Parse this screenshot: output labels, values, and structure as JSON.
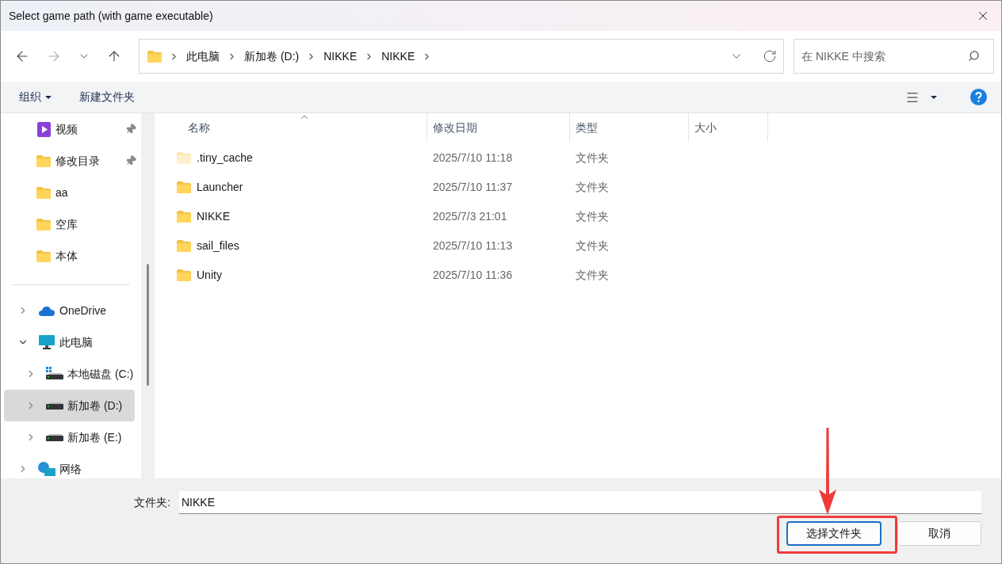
{
  "window": {
    "title": "Select game path (with game executable)"
  },
  "address_bar": {
    "crumbs": [
      "此电脑",
      "新加卷 (D:)",
      "NIKKE",
      "NIKKE"
    ]
  },
  "search": {
    "placeholder": "在 NIKKE 中搜索"
  },
  "toolbar": {
    "organize": "组织",
    "new_folder": "新建文件夹"
  },
  "sidebar": {
    "quick_access": [
      {
        "label": "视频",
        "kind": "video",
        "pinned": true
      },
      {
        "label": "修改目录",
        "kind": "folder",
        "pinned": true
      },
      {
        "label": "aa",
        "kind": "folder",
        "pinned": false
      },
      {
        "label": "空库",
        "kind": "folder",
        "pinned": false
      },
      {
        "label": "本体",
        "kind": "folder",
        "pinned": false
      }
    ],
    "tree": [
      {
        "label": "OneDrive",
        "kind": "cloud",
        "expanded": false,
        "selected": false
      },
      {
        "label": "此电脑",
        "kind": "pc",
        "expanded": true,
        "selected": false,
        "children": [
          {
            "label": "本地磁盘 (C:)",
            "kind": "system-drive",
            "expanded": false,
            "selected": false
          },
          {
            "label": "新加卷 (D:)",
            "kind": "drive",
            "expanded": false,
            "selected": true
          },
          {
            "label": "新加卷 (E:)",
            "kind": "drive",
            "expanded": false,
            "selected": false
          }
        ]
      },
      {
        "label": "网络",
        "kind": "network",
        "expanded": false,
        "selected": false
      }
    ]
  },
  "table": {
    "columns": [
      "名称",
      "修改日期",
      "类型",
      "大小"
    ],
    "rows": [
      {
        "name": ".tiny_cache",
        "modified": "2025/7/10 11:18",
        "type": "文件夹",
        "hidden": true
      },
      {
        "name": "Launcher",
        "modified": "2025/7/10 11:37",
        "type": "文件夹",
        "hidden": false
      },
      {
        "name": "NIKKE",
        "modified": "2025/7/3 21:01",
        "type": "文件夹",
        "hidden": false
      },
      {
        "name": "sail_files",
        "modified": "2025/7/10 11:13",
        "type": "文件夹",
        "hidden": false
      },
      {
        "name": "Unity",
        "modified": "2025/7/10 11:36",
        "type": "文件夹",
        "hidden": false
      }
    ]
  },
  "footer": {
    "label": "文件夹:",
    "value": "NIKKE",
    "buttons": [
      {
        "label": "选择文件夹",
        "primary": true
      },
      {
        "label": "取消",
        "primary": false
      }
    ]
  }
}
